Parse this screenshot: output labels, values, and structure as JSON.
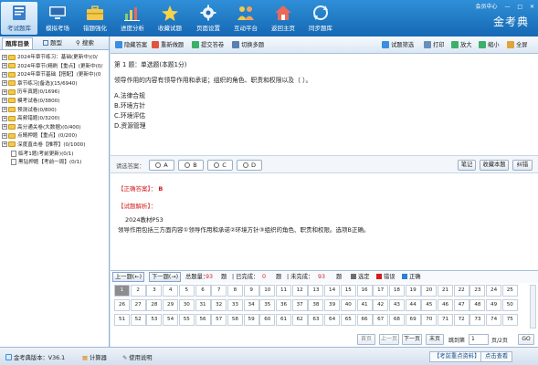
{
  "app": {
    "brand": "金考典",
    "window_user": "会员中心",
    "window_min": "—",
    "window_max": "□",
    "window_close": "✕"
  },
  "nav": [
    {
      "label": "考试题库",
      "icon": "exam-book-icon",
      "active": true
    },
    {
      "label": "模拟考场",
      "icon": "monitor-icon",
      "active": false
    },
    {
      "label": "错题强化",
      "icon": "briefcase-icon",
      "active": false
    },
    {
      "label": "进度分析",
      "icon": "bar-chart-icon",
      "active": false
    },
    {
      "label": "收藏试题",
      "icon": "star-icon",
      "active": false
    },
    {
      "label": "页面设置",
      "icon": "gear-icon",
      "active": false
    },
    {
      "label": "互动平台",
      "icon": "people-icon",
      "active": false
    },
    {
      "label": "返回主页",
      "icon": "home-icon",
      "active": false
    },
    {
      "label": "同步题库",
      "icon": "sync-icon",
      "active": false
    }
  ],
  "left": {
    "tab_catalog": "题库目录",
    "tab_topic": "题型",
    "tab_search": "搜索",
    "tree": [
      {
        "label": "2024年章节练习：基础(更新中)(0/",
        "expand": "+",
        "sub": false,
        "doc": false
      },
      {
        "label": "2024年章节(精刷【重点】(更新中(0/",
        "expand": "+",
        "sub": false,
        "doc": false
      },
      {
        "label": "2024年章节基础【搭配】(更新中)(0",
        "expand": "+",
        "sub": false,
        "doc": false
      },
      {
        "label": "章节练习[备选](15/6940)",
        "expand": "+",
        "sub": false,
        "doc": false
      },
      {
        "label": "历年真题(0/1696)",
        "expand": "+",
        "sub": false,
        "doc": false
      },
      {
        "label": "模考试卷(0/3800)",
        "expand": "+",
        "sub": false,
        "doc": false
      },
      {
        "label": "预测试卷(0/800)",
        "expand": "+",
        "sub": false,
        "doc": false
      },
      {
        "label": "高频错题(0/3200)",
        "expand": "+",
        "sub": false,
        "doc": false
      },
      {
        "label": "高分通关卷(大数据)(0/400)",
        "expand": "+",
        "sub": false,
        "doc": false
      },
      {
        "label": "点睛押题【重点】(0/200)",
        "expand": "+",
        "sub": false,
        "doc": false
      },
      {
        "label": "深度直击卷【推荐】(0/1000)",
        "expand": "+",
        "sub": false,
        "doc": false
      },
      {
        "label": "临考1题(考前更新)(0/1)",
        "expand": "",
        "sub": true,
        "doc": true
      },
      {
        "label": "黑钻押题【考前一周】(0/1)",
        "expand": "",
        "sub": true,
        "doc": true
      }
    ]
  },
  "toolbar2": {
    "hide_answer": "隐藏答案",
    "redo": "重新做题",
    "submit": "提交答卷",
    "switch": "切换多题",
    "filter": "试题筛选",
    "print": "打印",
    "zoom_in": "放大",
    "zoom_out": "缩小",
    "fullscreen": "全屏"
  },
  "question": {
    "header": "第 1 题：单选题(本题1分)",
    "stem": "领导作用的内容有领导作用和承诺；组织的角色、职责和权限以及（ ）。",
    "options": [
      "A.法律合规",
      "B.环境方针",
      "C.环境评估",
      "D.资源管理"
    ]
  },
  "answer_bar": {
    "label": "请选答案：",
    "choices": [
      "A",
      "B",
      "C",
      "D"
    ],
    "note": "笔记",
    "collect": "收藏本题",
    "error": "纠错"
  },
  "analysis": {
    "correct_label": "【正确答案】：",
    "correct_value": "B",
    "explain_label": "【试题解析】：",
    "source": "2024教材P53",
    "text": "领导作用包括三方面内容①领导作用和承诺②环境方针③组织的角色、职责和权限。选项B正确。"
  },
  "stats": {
    "prev": "上一题(←)",
    "next": "下一题(→)",
    "total_label": "总题量：",
    "total": "93",
    "unit": "题",
    "done_label": "| 已完成：",
    "done": "0",
    "undone_label": "| 未完成：",
    "undone": "93",
    "legend_selected": "选定",
    "legend_wrong": "错误",
    "legend_right": "正确",
    "colors": {
      "selected": "#6e6e6e",
      "wrong": "#d41c1c",
      "right": "#2f7fd8"
    }
  },
  "grid": {
    "cells": [
      "1",
      "2",
      "3",
      "4",
      "5",
      "6",
      "7",
      "8",
      "9",
      "10",
      "11",
      "12",
      "13",
      "14",
      "15",
      "16",
      "17",
      "18",
      "19",
      "20",
      "21",
      "22",
      "23",
      "24",
      "25",
      "26",
      "27",
      "28",
      "29",
      "30",
      "31",
      "32",
      "33",
      "34",
      "35",
      "36",
      "37",
      "38",
      "39",
      "40",
      "41",
      "42",
      "43",
      "44",
      "45",
      "46",
      "47",
      "48",
      "49",
      "50",
      "51",
      "52",
      "53",
      "54",
      "55",
      "56",
      "57",
      "58",
      "59",
      "60",
      "61",
      "62",
      "63",
      "64",
      "65",
      "66",
      "67",
      "68",
      "69",
      "70",
      "71",
      "72",
      "73",
      "74",
      "75"
    ],
    "current": 1
  },
  "pager": {
    "first": "首页",
    "prev": "上一页",
    "next": "下一页",
    "last": "末页",
    "jump_label": "跳到第",
    "page_value": "1",
    "page_suffix": "页/2页",
    "go": "GO"
  },
  "status": {
    "version": "金考典版本：V36.1",
    "calculator": "计算器",
    "help": "使用说明",
    "link1": "【考前重点资料】",
    "link2": "点击查看"
  }
}
